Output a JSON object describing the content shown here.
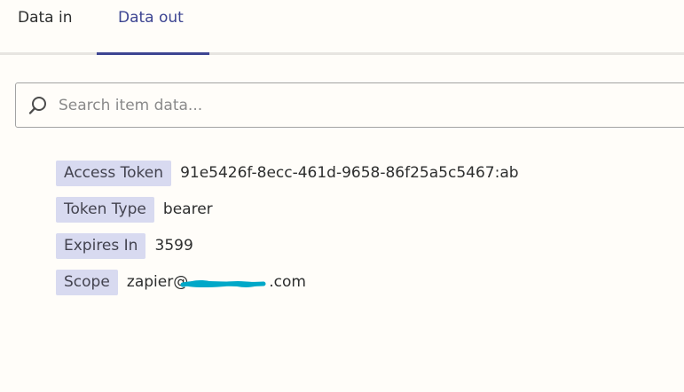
{
  "tabs": [
    {
      "label": "Data in",
      "active": false
    },
    {
      "label": "Data out",
      "active": true
    }
  ],
  "search": {
    "placeholder": "Search item data...",
    "value": ""
  },
  "fields": [
    {
      "key": "Access Token",
      "value": "91e5426f-8ecc-461d-9658-86f25a5c5467:ab"
    },
    {
      "key": "Token Type",
      "value": "bearer"
    },
    {
      "key": "Expires In",
      "value": "3599"
    },
    {
      "key": "Scope",
      "value": "zapier@",
      "value_suffix": ".com",
      "redacted": true
    }
  ],
  "colors": {
    "accent": "#3d4592",
    "key_background": "#d8daf0",
    "redaction": "#00a8c8",
    "page_background": "#fffdf9"
  },
  "icons": {
    "search": "search-icon"
  }
}
